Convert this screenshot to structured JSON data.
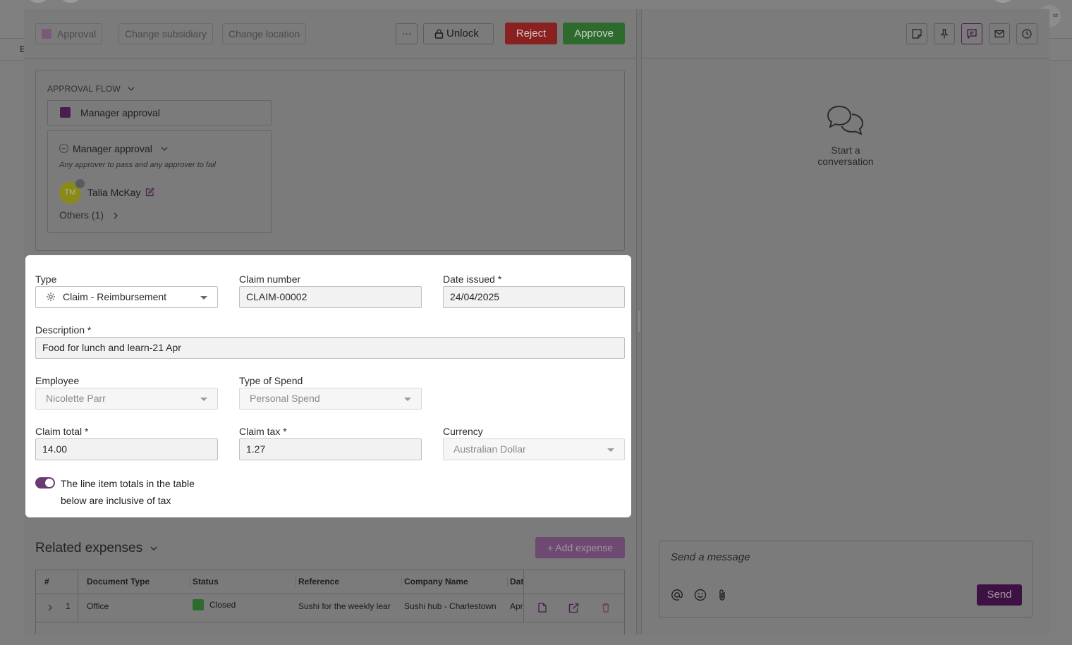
{
  "background": {
    "nav_letter": "E",
    "corner_badge": "ist"
  },
  "toolbar": {
    "approval_chip": "Approval",
    "change_subsidiary": "Change subsidiary",
    "change_location": "Change location",
    "more_label": "···",
    "unlock_label": "Unlock",
    "reject_label": "Reject",
    "approve_label": "Approve"
  },
  "approval_flow": {
    "title": "APPROVAL FLOW",
    "stage_label": "Manager approval",
    "step": {
      "title": "Manager approval",
      "rule": "Any approver to pass and any approver to fail",
      "approver_initials": "TM",
      "approver_name": "Talia McKay",
      "others_label": "Others (1)"
    }
  },
  "form": {
    "type": {
      "label": "Type",
      "value": "Claim - Reimbursement"
    },
    "claim_number": {
      "label": "Claim number",
      "value": "CLAIM-00002"
    },
    "date_issued": {
      "label": "Date issued *",
      "value": "24/04/2025"
    },
    "description": {
      "label": "Description *",
      "value": "Food for lunch and learn-21 Apr"
    },
    "employee": {
      "label": "Employee",
      "value": "Nicolette Parr"
    },
    "type_of_spend": {
      "label": "Type of Spend",
      "value": "Personal Spend"
    },
    "claim_total": {
      "label": "Claim total *",
      "value": "14.00"
    },
    "claim_tax": {
      "label": "Claim tax *",
      "value": "1.27"
    },
    "currency": {
      "label": "Currency",
      "value": "Australian Dollar"
    },
    "tax_inclusive": {
      "on": true,
      "line1": "The line item totals in the table",
      "line2": "below are inclusive of tax"
    }
  },
  "related_expenses": {
    "title": "Related expenses",
    "add_label": "+ Add expense",
    "columns": [
      "#",
      "Document Type",
      "Status",
      "Reference",
      "Company Name",
      "Dat"
    ],
    "rows": [
      {
        "index": "1",
        "document_type": "Office",
        "status": "Closed",
        "status_color": "#2f6b2f",
        "reference": "Sushi for the weekly lear",
        "company": "Sushi hub - Charlestown",
        "date": "Apr"
      }
    ]
  },
  "conversation": {
    "empty_text": "Start a conversation",
    "placeholder": "Send a message",
    "send_label": "Send"
  },
  "colors": {
    "accent": "#4a1d4f",
    "reject": "#b32b2b",
    "approve": "#3c8a3c",
    "toggle": "#6a3a72"
  }
}
